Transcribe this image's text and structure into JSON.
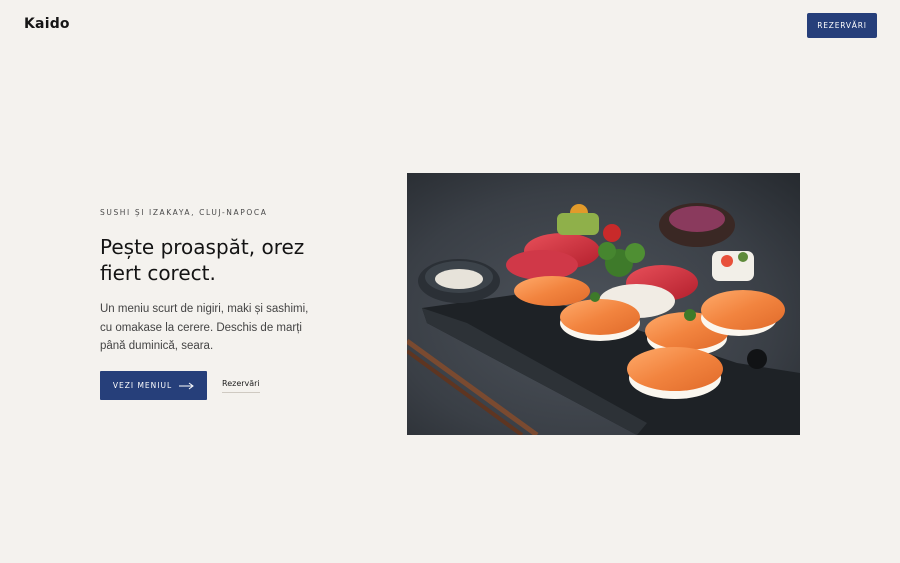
{
  "header": {
    "brand": "Kaido",
    "reserve_button": "REZERVĂRI"
  },
  "hero": {
    "eyebrow": "SUSHI ȘI IZAKAYA, CLUJ-NAPOCA",
    "headline": "Pește proaspăt, orez fiert corect.",
    "description": "Un meniu scurt de nigiri, maki și sashimi, cu omakase la cerere. Deschis de marți până duminică, seara.",
    "primary_button": "VEZI MENIUL",
    "secondary_link": "Rezervări"
  },
  "colors": {
    "accent": "#263f7a",
    "background": "#f4f2ee"
  },
  "icons": {
    "primary_button_icon": "arrow-right-icon"
  }
}
